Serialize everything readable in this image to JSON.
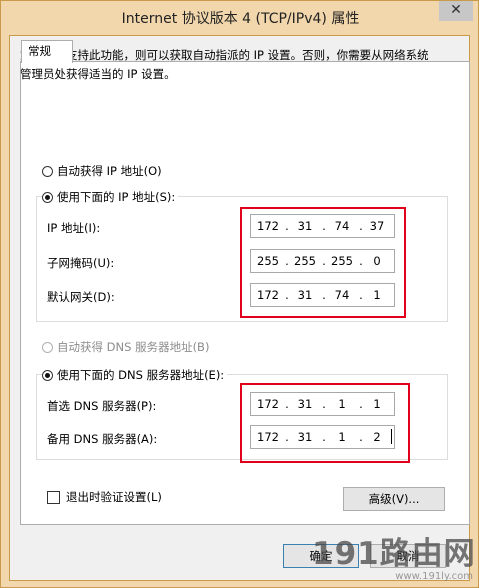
{
  "window": {
    "title": "Internet 协议版本 4 (TCP/IPv4) 属性",
    "close_glyph": "✕"
  },
  "tabs": [
    "常规"
  ],
  "intro_text": "如果网络支持此功能，则可以获取自动指派的 IP 设置。否则，你需要从网络系统管理员处获得适当的 IP 设置。",
  "ip_section": {
    "auto_option": "自动获得 IP 地址(O)",
    "manual_option": "使用下面的 IP 地址(S):",
    "selected": "manual",
    "fields": [
      {
        "label": "IP 地址(I):",
        "value": [
          "172",
          "31",
          "74",
          "37"
        ]
      },
      {
        "label": "子网掩码(U):",
        "value": [
          "255",
          "255",
          "255",
          "0"
        ]
      },
      {
        "label": "默认网关(D):",
        "value": [
          "172",
          "31",
          "74",
          "1"
        ]
      }
    ]
  },
  "dns_section": {
    "auto_option": "自动获得 DNS 服务器地址(B)",
    "manual_option": "使用下面的 DNS 服务器地址(E):",
    "selected": "manual",
    "fields": [
      {
        "label": "首选 DNS 服务器(P):",
        "value": [
          "172",
          "31",
          "1",
          "1"
        ]
      },
      {
        "label": "备用 DNS 服务器(A):",
        "value": [
          "172",
          "31",
          "1",
          "2"
        ]
      }
    ]
  },
  "validate_checkbox": {
    "label": "退出时验证设置(L)",
    "checked": false
  },
  "buttons": {
    "advanced": "高级(V)...",
    "ok": "确定",
    "cancel": "取消"
  },
  "watermark": {
    "brand": "191路由网",
    "url": "www.191ly.com"
  },
  "colors": {
    "frame": "#f2d7ac",
    "highlight": "#e0001b",
    "dialog": "#f0f0f0"
  }
}
